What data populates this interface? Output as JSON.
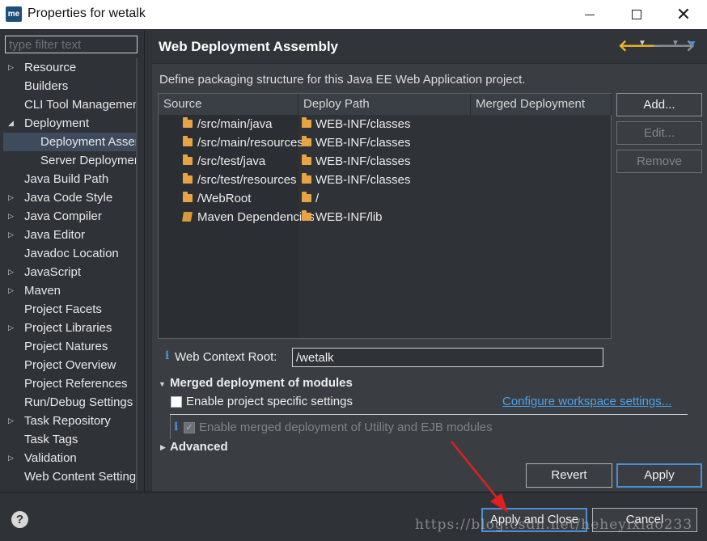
{
  "window": {
    "logo": "me",
    "title": "Properties for wetalk"
  },
  "filter": {
    "placeholder": "type filter text"
  },
  "nav": {
    "items": [
      {
        "label": "Resource",
        "arrow": "▷"
      },
      {
        "label": "Builders",
        "arrow": ""
      },
      {
        "label": "CLI Tool Management",
        "arrow": ""
      },
      {
        "label": "Deployment",
        "arrow": "◢"
      },
      {
        "label": "Deployment Assembly",
        "arrow": "",
        "child": true,
        "selected": true
      },
      {
        "label": "Server Deployment",
        "arrow": "",
        "child": true
      },
      {
        "label": "Java Build Path",
        "arrow": ""
      },
      {
        "label": "Java Code Style",
        "arrow": "▷"
      },
      {
        "label": "Java Compiler",
        "arrow": "▷"
      },
      {
        "label": "Java Editor",
        "arrow": "▷"
      },
      {
        "label": "Javadoc Location",
        "arrow": ""
      },
      {
        "label": "JavaScript",
        "arrow": "▷"
      },
      {
        "label": "Maven",
        "arrow": "▷"
      },
      {
        "label": "Project Facets",
        "arrow": ""
      },
      {
        "label": "Project Libraries",
        "arrow": "▷"
      },
      {
        "label": "Project Natures",
        "arrow": ""
      },
      {
        "label": "Project Overview",
        "arrow": ""
      },
      {
        "label": "Project References",
        "arrow": ""
      },
      {
        "label": "Run/Debug Settings",
        "arrow": ""
      },
      {
        "label": "Task Repository",
        "arrow": "▷"
      },
      {
        "label": "Task Tags",
        "arrow": ""
      },
      {
        "label": "Validation",
        "arrow": "▷"
      },
      {
        "label": "Web Content Settings",
        "arrow": ""
      }
    ]
  },
  "page": {
    "title": "Web Deployment Assembly",
    "description": "Define packaging structure for this Java EE Web Application project."
  },
  "table": {
    "columns": [
      "Source",
      "Deploy Path",
      "Merged Deployment"
    ],
    "rows": [
      {
        "source": "/src/main/java",
        "deploy": "WEB-INF/classes",
        "icon": "folder-icon"
      },
      {
        "source": "/src/main/resources",
        "deploy": "WEB-INF/classes",
        "icon": "folder-icon"
      },
      {
        "source": "/src/test/java",
        "deploy": "WEB-INF/classes",
        "icon": "folder-icon"
      },
      {
        "source": "/src/test/resources",
        "deploy": "WEB-INF/classes",
        "icon": "folder-icon"
      },
      {
        "source": "/WebRoot",
        "deploy": "/",
        "icon": "folder-icon"
      },
      {
        "source": "Maven Dependencies",
        "deploy": "WEB-INF/lib",
        "icon": "library-icon"
      }
    ]
  },
  "side_buttons": {
    "add": "Add...",
    "edit": "Edit...",
    "remove": "Remove"
  },
  "context_root": {
    "label": "Web Context Root:",
    "value": "/wetalk"
  },
  "merged": {
    "title": "Merged deployment of modules",
    "enable_specific": "Enable project specific settings",
    "configure_link": "Configure workspace settings...",
    "enable_merged": "Enable merged deployment of Utility and EJB modules"
  },
  "advanced": {
    "title": "Advanced"
  },
  "buttons": {
    "revert": "Revert",
    "apply": "Apply",
    "apply_close": "Apply and Close",
    "cancel": "Cancel"
  },
  "help": "?",
  "watermark": "https://blog.csdn.net/heheyixiao233",
  "colors": {
    "link": "#4aa3e8",
    "accent": "#4a90d9",
    "back_arrow": "#f0b429",
    "folder": "#e8a444",
    "annotation_arrow": "#e02020"
  }
}
